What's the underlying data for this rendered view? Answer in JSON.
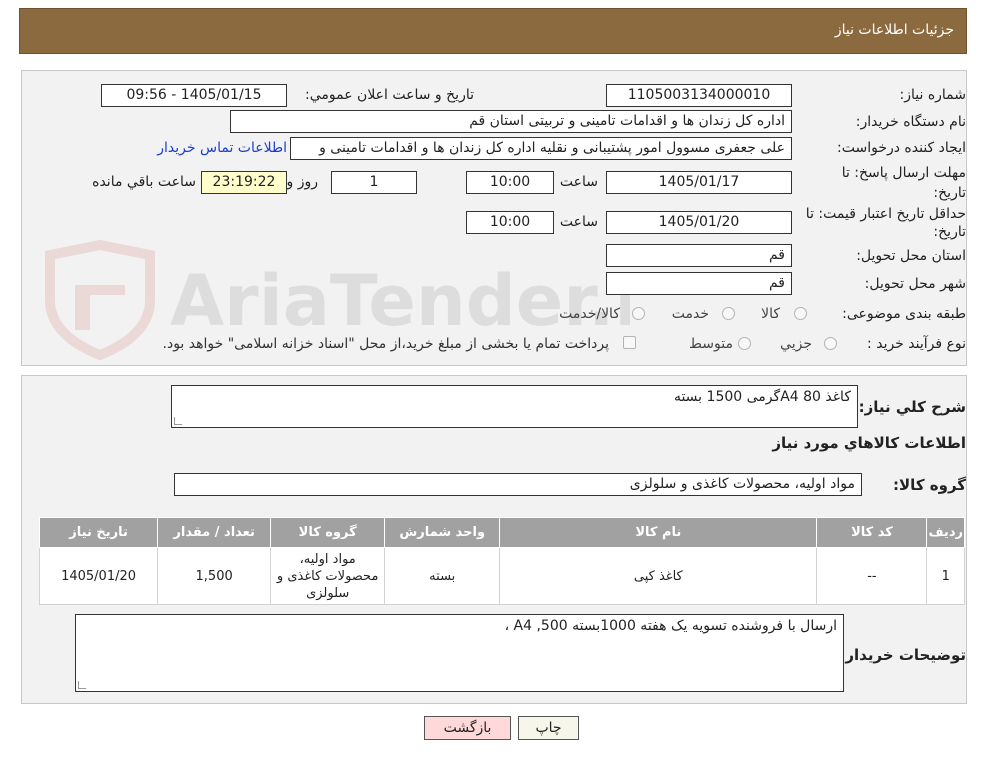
{
  "header": {
    "title": "جزئیات اطلاعات نیاز"
  },
  "form": {
    "need_number_label": "شماره نیاز:",
    "need_number": "1105003134000010",
    "announce_label": "تاریخ و ساعت اعلان عمومي:",
    "announce_value": "1405/01/15 - 09:56",
    "buyer_label": "نام دستگاه خريدار:",
    "buyer_value": "اداره کل زندان ها و اقدامات تامینی و تربیتی استان قم",
    "creator_label": "ايجاد کننده درخواست:",
    "creator_value": "علی جعفری مسوول امور پشتیبانی و نقلیه اداره کل زندان ها و اقدامات تامینی و",
    "contact_link": "اطلاعات تماس خريدار",
    "deadline_label_1": "مهلت ارسال پاسخ: تا",
    "deadline_label_2": "تاريخ:",
    "deadline_date": "1405/01/17",
    "time_label": "ساعت",
    "deadline_time": "10:00",
    "days_value": "1",
    "days_label": "روز و",
    "remaining_time": "23:19:22",
    "remaining_label": "ساعت باقي مانده",
    "validity_label_1": "حداقل تاريخ اعتبار قيمت: تا",
    "validity_label_2": "تاريخ:",
    "validity_date": "1405/01/20",
    "validity_time": "10:00",
    "province_label": "استان محل تحويل:",
    "province_value": "قم",
    "city_label": "شهر محل تحويل:",
    "city_value": "قم",
    "category_label": "طبقه بندی موضوعی:",
    "category_options": [
      "کالا",
      "خدمت",
      "کالا/خدمت"
    ],
    "process_label": "نوع فرآيند خريد :",
    "process_options": [
      "جزيي",
      "متوسط"
    ],
    "payment_note": "پرداخت تمام يا بخشی از مبلغ خريد،از محل \"اسناد خزانه اسلامی\" خواهد بود."
  },
  "summary": {
    "desc_label": "شرح کلي نياز:",
    "desc_value": "کاغذ A4 80گرمی 1500 بسته",
    "items_title": "اطلاعات کالاهاي مورد نياز",
    "group_label": "گروه کالا:",
    "group_value": "مواد اولیه، محصولات کاغذی و سلولزی"
  },
  "table": {
    "headers": [
      "رديف",
      "کد کالا",
      "نام کالا",
      "واحد شمارش",
      "گروه کالا",
      "تعداد / مقدار",
      "تاريخ نياز"
    ],
    "rows": [
      [
        "1",
        "--",
        "کاغذ کپی",
        "بسته",
        "مواد اولیه، محصولات کاغذی و سلولزی",
        "1,500",
        "1405/01/20"
      ]
    ]
  },
  "notes": {
    "label": "توضيحات خريدار:",
    "value": "ارسال با فروشنده تسویه یک هفته  1000بسته A4 ,500 ،"
  },
  "buttons": {
    "print": "چاپ",
    "back": "بازگشت"
  },
  "watermark": {
    "text": "AriaTender.neT"
  },
  "colors": {
    "header_bg": "#8c6a3f",
    "table_header_bg": "#a1a1a1",
    "back_button_bg": "#ffd9d9",
    "link": "#1a3fd0"
  }
}
